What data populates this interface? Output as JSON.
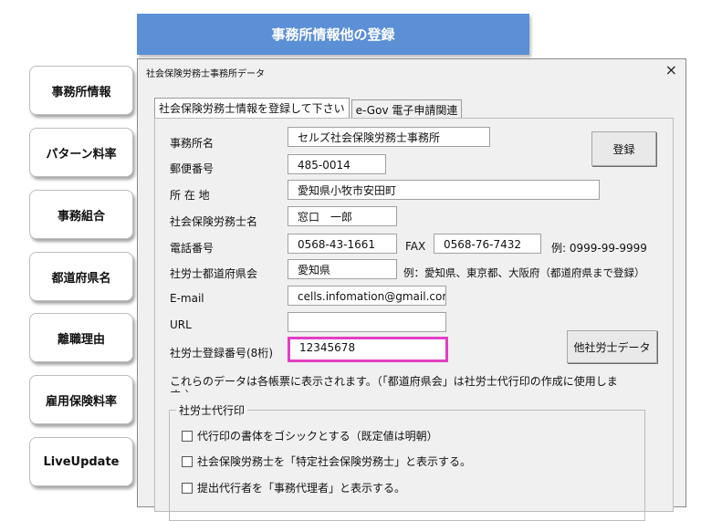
{
  "banner": {
    "title": "事務所情報他の登録"
  },
  "nav": [
    {
      "label": "事務所情報"
    },
    {
      "label": "パターン料率"
    },
    {
      "label": "事務組合"
    },
    {
      "label": "都道府県名"
    },
    {
      "label": "離職理由"
    },
    {
      "label": "雇用保険料率"
    },
    {
      "label": "LiveUpdate"
    }
  ],
  "dialog": {
    "title": "社会保険労務士事務所データ",
    "close_glyph": "×",
    "tabs": [
      {
        "label": "社会保険労務士情報を登録して下さい"
      },
      {
        "label": "e-Gov 電子申請関連"
      }
    ],
    "form": {
      "office_name": {
        "label": "事務所名",
        "value": "セルズ社会保険労務士事務所"
      },
      "postal": {
        "label": "郵便番号",
        "value": "485-0014"
      },
      "address": {
        "label": "所 在 地",
        "value": "愛知県小牧市安田町"
      },
      "name": {
        "label": "社会保険労務士名",
        "value": "窓口　一郎"
      },
      "phone": {
        "label": "電話番号",
        "value": "0568-43-1661"
      },
      "fax": {
        "label": "FAX",
        "value": "0568-76-7432",
        "example": "例:  0999-99-9999"
      },
      "prefecture_assoc": {
        "label": "社労士都道府県会",
        "value": "愛知県",
        "example": "例：愛知県、東京都、大阪府（都道府県まで登録）"
      },
      "email": {
        "label": "E-mail",
        "value": "cells.infomation@gmail.com"
      },
      "url": {
        "label": "URL",
        "value": ""
      },
      "reg_number": {
        "label": "社労士登録番号(8桁)",
        "value": "12345678"
      }
    },
    "buttons": {
      "register": "登録",
      "other_data": "他社労士データ"
    },
    "note": "これらのデータは各帳票に表示されます。（「都道府県会」は社労士代行印の作成に使用しま",
    "note_cut": "す。）",
    "group": {
      "title": "社労士代行印",
      "options": [
        {
          "label": "代行印の書体をゴシックとする（既定値は明朝）"
        },
        {
          "label": "社会保険労務士を「特定社会保険労務士」と表示する。"
        },
        {
          "label": "提出代行者を「事務代理者」と表示する。"
        }
      ]
    }
  }
}
